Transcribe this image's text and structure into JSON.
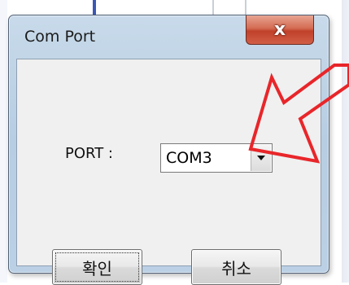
{
  "dialog": {
    "title": "Com Port",
    "close_symbol": "x",
    "port_label": "PORT :",
    "port_value": "COM3",
    "ok_label": "확인",
    "cancel_label": "취소"
  },
  "icons": {
    "close": "close-icon",
    "dropdown": "chevron-down-icon",
    "annotation": "red-arrow-annotation"
  },
  "colors": {
    "annotation": "#e8262a",
    "window_frame": "#bcd1e5",
    "close_button": "#c9503b"
  }
}
